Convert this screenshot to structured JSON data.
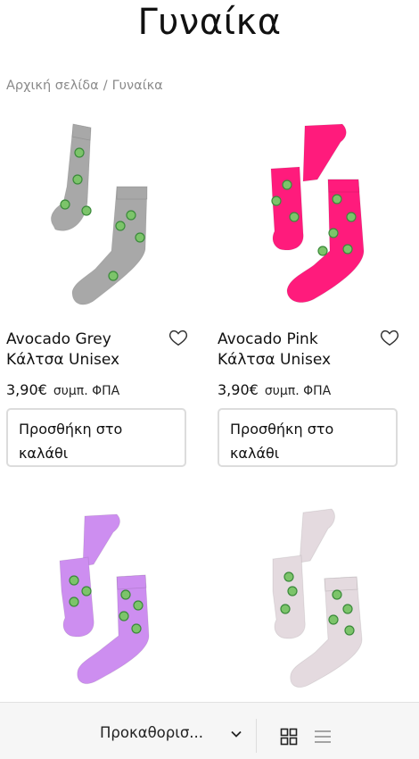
{
  "page": {
    "title": "Γυναίκα"
  },
  "breadcrumb": {
    "home": "Αρχική σελίδα",
    "separator": "/",
    "current": "Γυναίκα"
  },
  "products": [
    {
      "name_line1": "Avocado Grey",
      "name_line2": "Κάλτσα Unisex",
      "price": "3,90€",
      "vat": "συμπ. ΦΠΑ",
      "button": "Προσθήκη στο καλάθι",
      "sock_color": "#a8a8a8"
    },
    {
      "name_line1": "Avocado Pink",
      "name_line2": "Κάλτσα Unisex",
      "price": "3,90€",
      "vat": "συμπ. ΦΠΑ",
      "button": "Προσθήκη στο καλάθι",
      "sock_color": "#ff1b7c"
    },
    {
      "sock_color": "#cd8ef0"
    },
    {
      "sock_color": "#e4dadf"
    }
  ],
  "toolbar": {
    "sort_label": "Προκαθορισ...",
    "icons": [
      "chevron-down-icon",
      "grid-view-icon",
      "list-view-icon"
    ]
  },
  "colors": {
    "text": "#111111",
    "muted": "#8a8a8a",
    "border": "#dcdcdc",
    "bar_bg": "#f6f6f6"
  }
}
